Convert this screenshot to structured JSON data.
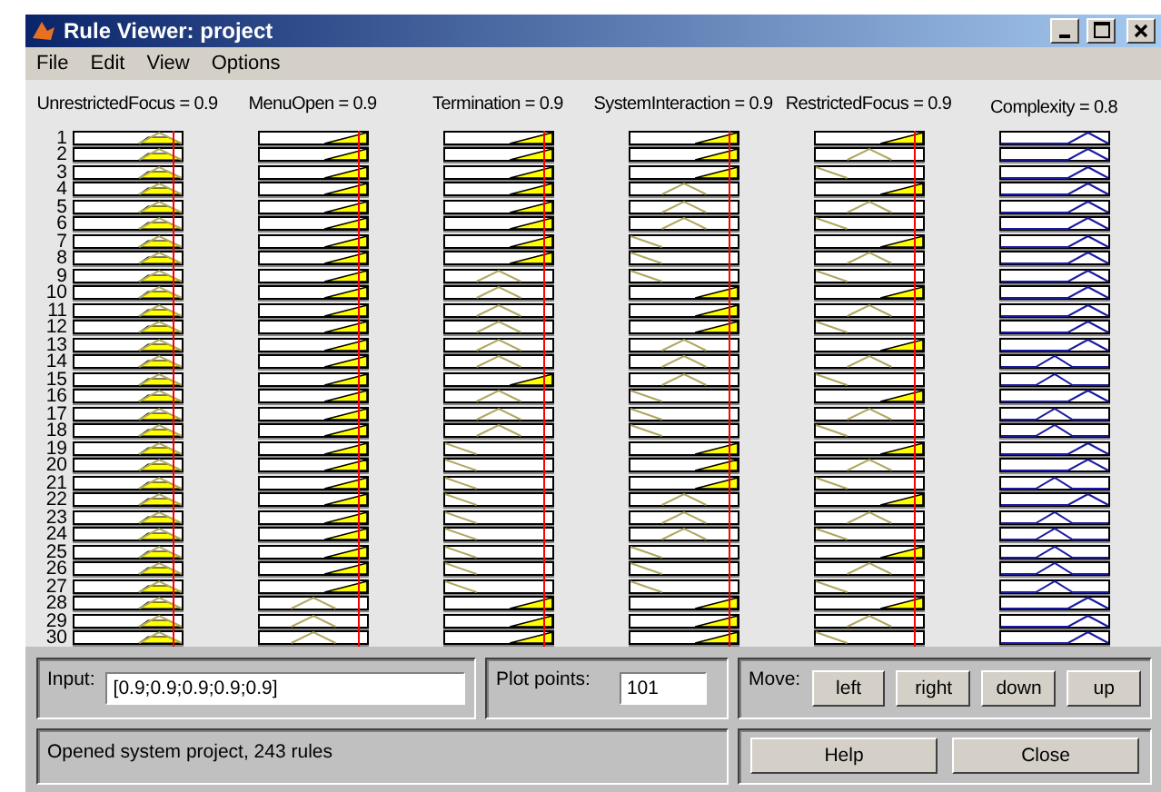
{
  "window": {
    "title": "Rule Viewer: project"
  },
  "menu": [
    "File",
    "Edit",
    "View",
    "Options"
  ],
  "variables": [
    {
      "label": "UnrestrictedFocus = 0.9",
      "kind": "input",
      "level": 0.9
    },
    {
      "label": "MenuOpen = 0.9",
      "kind": "input",
      "level": 0.9
    },
    {
      "label": "Termination = 0.9",
      "kind": "input",
      "level": 0.9
    },
    {
      "label": "SystemInteraction = 0.9",
      "kind": "input",
      "level": 0.9
    },
    {
      "label": "RestrictedFocus = 0.9",
      "kind": "input",
      "level": 0.9
    },
    {
      "label": "Complexity = 0.8",
      "kind": "output"
    }
  ],
  "rules": [
    {
      "number": "1",
      "plots": [
        {
          "kind": "peak"
        },
        {
          "kind": "high"
        },
        {
          "kind": "high"
        },
        {
          "kind": "high"
        },
        {
          "kind": "high"
        },
        {
          "kind": "out_high"
        }
      ]
    },
    {
      "number": "2",
      "plots": [
        {
          "kind": "peak"
        },
        {
          "kind": "high"
        },
        {
          "kind": "high"
        },
        {
          "kind": "high"
        },
        {
          "kind": "mid"
        },
        {
          "kind": "out_high"
        }
      ]
    },
    {
      "number": "3",
      "plots": [
        {
          "kind": "peak"
        },
        {
          "kind": "high"
        },
        {
          "kind": "high"
        },
        {
          "kind": "high"
        },
        {
          "kind": "low"
        },
        {
          "kind": "out_high"
        }
      ]
    },
    {
      "number": "4",
      "plots": [
        {
          "kind": "peak"
        },
        {
          "kind": "high"
        },
        {
          "kind": "high"
        },
        {
          "kind": "mid"
        },
        {
          "kind": "high"
        },
        {
          "kind": "out_high"
        }
      ]
    },
    {
      "number": "5",
      "plots": [
        {
          "kind": "peak"
        },
        {
          "kind": "high"
        },
        {
          "kind": "high"
        },
        {
          "kind": "mid"
        },
        {
          "kind": "mid"
        },
        {
          "kind": "out_high"
        }
      ]
    },
    {
      "number": "6",
      "plots": [
        {
          "kind": "peak"
        },
        {
          "kind": "high"
        },
        {
          "kind": "high"
        },
        {
          "kind": "mid"
        },
        {
          "kind": "low"
        },
        {
          "kind": "out_high"
        }
      ]
    },
    {
      "number": "7",
      "plots": [
        {
          "kind": "peak"
        },
        {
          "kind": "high"
        },
        {
          "kind": "high"
        },
        {
          "kind": "low"
        },
        {
          "kind": "high"
        },
        {
          "kind": "out_high"
        }
      ]
    },
    {
      "number": "8",
      "plots": [
        {
          "kind": "peak"
        },
        {
          "kind": "high"
        },
        {
          "kind": "high"
        },
        {
          "kind": "low"
        },
        {
          "kind": "mid"
        },
        {
          "kind": "out_high"
        }
      ]
    },
    {
      "number": "9",
      "plots": [
        {
          "kind": "peak"
        },
        {
          "kind": "high"
        },
        {
          "kind": "mid"
        },
        {
          "kind": "low"
        },
        {
          "kind": "low"
        },
        {
          "kind": "out_high"
        }
      ]
    },
    {
      "number": "10",
      "plots": [
        {
          "kind": "peak"
        },
        {
          "kind": "high"
        },
        {
          "kind": "mid"
        },
        {
          "kind": "high"
        },
        {
          "kind": "high"
        },
        {
          "kind": "out_high"
        }
      ]
    },
    {
      "number": "11",
      "plots": [
        {
          "kind": "peak"
        },
        {
          "kind": "high"
        },
        {
          "kind": "mid"
        },
        {
          "kind": "high"
        },
        {
          "kind": "mid"
        },
        {
          "kind": "out_high"
        }
      ]
    },
    {
      "number": "12",
      "plots": [
        {
          "kind": "peak"
        },
        {
          "kind": "high"
        },
        {
          "kind": "mid"
        },
        {
          "kind": "high"
        },
        {
          "kind": "low"
        },
        {
          "kind": "out_high"
        }
      ]
    },
    {
      "number": "13",
      "plots": [
        {
          "kind": "peak"
        },
        {
          "kind": "high"
        },
        {
          "kind": "mid"
        },
        {
          "kind": "mid"
        },
        {
          "kind": "high"
        },
        {
          "kind": "out_high"
        }
      ]
    },
    {
      "number": "14",
      "plots": [
        {
          "kind": "peak"
        },
        {
          "kind": "high"
        },
        {
          "kind": "mid"
        },
        {
          "kind": "mid"
        },
        {
          "kind": "mid"
        },
        {
          "kind": "out_mid"
        }
      ]
    },
    {
      "number": "15",
      "plots": [
        {
          "kind": "peak"
        },
        {
          "kind": "high"
        },
        {
          "kind": "high"
        },
        {
          "kind": "mid"
        },
        {
          "kind": "low"
        },
        {
          "kind": "out_mid"
        }
      ]
    },
    {
      "number": "16",
      "plots": [
        {
          "kind": "peak"
        },
        {
          "kind": "high"
        },
        {
          "kind": "mid"
        },
        {
          "kind": "low"
        },
        {
          "kind": "high"
        },
        {
          "kind": "out_high"
        }
      ]
    },
    {
      "number": "17",
      "plots": [
        {
          "kind": "peak"
        },
        {
          "kind": "high"
        },
        {
          "kind": "mid"
        },
        {
          "kind": "low"
        },
        {
          "kind": "mid"
        },
        {
          "kind": "out_mid"
        }
      ]
    },
    {
      "number": "18",
      "plots": [
        {
          "kind": "peak"
        },
        {
          "kind": "high"
        },
        {
          "kind": "mid"
        },
        {
          "kind": "low"
        },
        {
          "kind": "low"
        },
        {
          "kind": "out_mid"
        }
      ]
    },
    {
      "number": "19",
      "plots": [
        {
          "kind": "peak"
        },
        {
          "kind": "high"
        },
        {
          "kind": "low"
        },
        {
          "kind": "high"
        },
        {
          "kind": "high"
        },
        {
          "kind": "out_high"
        }
      ]
    },
    {
      "number": "20",
      "plots": [
        {
          "kind": "peak"
        },
        {
          "kind": "high"
        },
        {
          "kind": "low"
        },
        {
          "kind": "high"
        },
        {
          "kind": "mid"
        },
        {
          "kind": "out_high"
        }
      ]
    },
    {
      "number": "21",
      "plots": [
        {
          "kind": "peak"
        },
        {
          "kind": "high"
        },
        {
          "kind": "low"
        },
        {
          "kind": "high"
        },
        {
          "kind": "low"
        },
        {
          "kind": "out_mid"
        }
      ]
    },
    {
      "number": "22",
      "plots": [
        {
          "kind": "peak"
        },
        {
          "kind": "high"
        },
        {
          "kind": "low"
        },
        {
          "kind": "mid"
        },
        {
          "kind": "high"
        },
        {
          "kind": "out_high"
        }
      ]
    },
    {
      "number": "23",
      "plots": [
        {
          "kind": "peak"
        },
        {
          "kind": "high"
        },
        {
          "kind": "low"
        },
        {
          "kind": "mid"
        },
        {
          "kind": "mid"
        },
        {
          "kind": "out_mid"
        }
      ]
    },
    {
      "number": "24",
      "plots": [
        {
          "kind": "peak"
        },
        {
          "kind": "high"
        },
        {
          "kind": "low"
        },
        {
          "kind": "mid"
        },
        {
          "kind": "low"
        },
        {
          "kind": "out_mid"
        }
      ]
    },
    {
      "number": "25",
      "plots": [
        {
          "kind": "peak"
        },
        {
          "kind": "high"
        },
        {
          "kind": "low"
        },
        {
          "kind": "low"
        },
        {
          "kind": "high"
        },
        {
          "kind": "out_mid"
        }
      ]
    },
    {
      "number": "26",
      "plots": [
        {
          "kind": "peak"
        },
        {
          "kind": "high"
        },
        {
          "kind": "low"
        },
        {
          "kind": "low"
        },
        {
          "kind": "mid"
        },
        {
          "kind": "out_mid"
        }
      ]
    },
    {
      "number": "27",
      "plots": [
        {
          "kind": "peak"
        },
        {
          "kind": "high"
        },
        {
          "kind": "low"
        },
        {
          "kind": "low"
        },
        {
          "kind": "low"
        },
        {
          "kind": "out_mid"
        }
      ]
    },
    {
      "number": "28",
      "plots": [
        {
          "kind": "peak"
        },
        {
          "kind": "mid"
        },
        {
          "kind": "high"
        },
        {
          "kind": "high"
        },
        {
          "kind": "high"
        },
        {
          "kind": "out_high"
        }
      ]
    },
    {
      "number": "29",
      "plots": [
        {
          "kind": "peak"
        },
        {
          "kind": "mid"
        },
        {
          "kind": "high"
        },
        {
          "kind": "high"
        },
        {
          "kind": "mid"
        },
        {
          "kind": "out_high"
        }
      ]
    },
    {
      "number": "30",
      "plots": [
        {
          "kind": "peak"
        },
        {
          "kind": "mid"
        },
        {
          "kind": "high"
        },
        {
          "kind": "high"
        },
        {
          "kind": "low"
        },
        {
          "kind": "out_high"
        }
      ]
    }
  ],
  "input": {
    "label": "Input:",
    "value": "[0.9;0.9;0.9;0.9;0.9]"
  },
  "plot_points": {
    "label": "Plot points:",
    "value": "101"
  },
  "move": {
    "label": "Move:",
    "buttons": [
      "left",
      "right",
      "down",
      "up"
    ]
  },
  "status": "Opened system project, 243 rules",
  "buttons": [
    "Help",
    "Close"
  ]
}
